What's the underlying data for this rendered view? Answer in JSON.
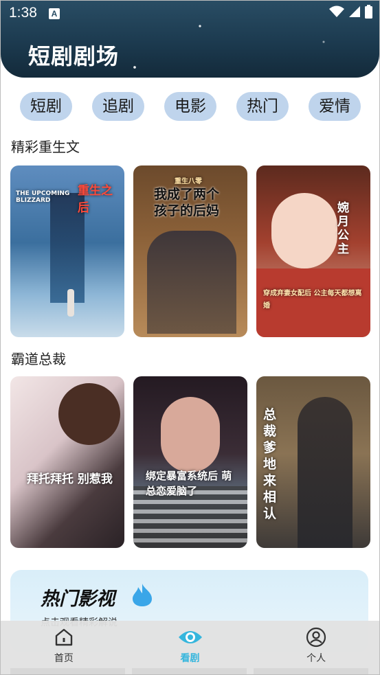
{
  "status_bar": {
    "time": "1:38",
    "badge": "A"
  },
  "header": {
    "title": "短剧剧场"
  },
  "chips": [
    "短剧",
    "追剧",
    "电影",
    "热门",
    "爱情"
  ],
  "sections": [
    {
      "title": "精彩重生文",
      "posters": [
        {
          "caption_main": "重生之后",
          "caption_sub": "THE UPCOMING BLIZZARD"
        },
        {
          "caption_main": "我成了两个孩子的后妈",
          "caption_sub": "重生八零"
        },
        {
          "caption_main": "婉月公主",
          "caption_sub": "穿成弃妻女配后 公主每天都想离婚"
        }
      ]
    },
    {
      "title": "霸道总裁",
      "posters": [
        {
          "caption_main": "拜托拜托 别惹我",
          "caption_sub": ""
        },
        {
          "caption_main": "绑定暴富系统后 萌总恋爱脑了",
          "caption_sub": ""
        },
        {
          "caption_main": "总裁爹地来相认",
          "caption_sub": ""
        }
      ]
    }
  ],
  "hot": {
    "title": "热门影视",
    "subtitle": "点击观看精彩解说"
  },
  "tabs": [
    {
      "label": "首页",
      "icon": "home-icon",
      "active": false
    },
    {
      "label": "看剧",
      "icon": "eye-icon",
      "active": true
    },
    {
      "label": "个人",
      "icon": "person-icon",
      "active": false
    }
  ],
  "colors": {
    "header": "#1f3e53",
    "chip": "#bfd4ec",
    "active_tab": "#35b6dd"
  }
}
